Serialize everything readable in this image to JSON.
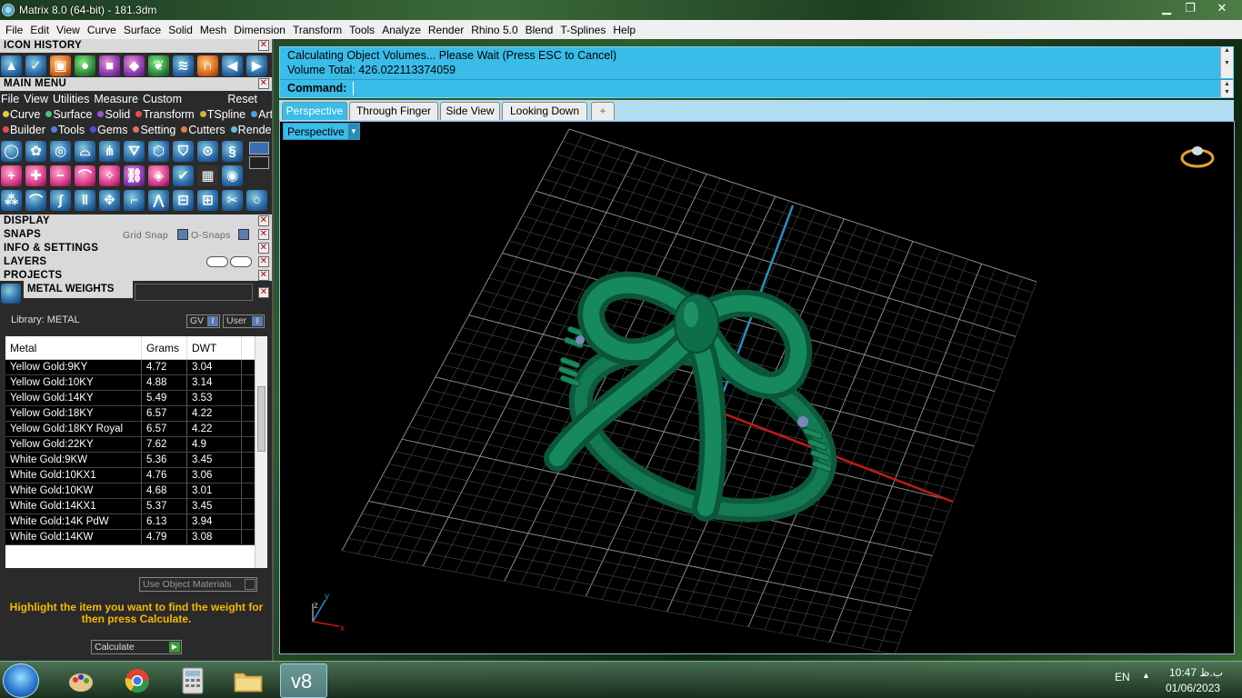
{
  "window": {
    "title": "Matrix 8.0 (64-bit) - 181.3dm",
    "min_label": "▁",
    "max_label": "❐",
    "close_label": "✕"
  },
  "menubar": [
    "File",
    "Edit",
    "View",
    "Curve",
    "Surface",
    "Solid",
    "Mesh",
    "Dimension",
    "Transform",
    "Tools",
    "Analyze",
    "Render",
    "Rhino 5.0",
    "Blend",
    "T-Splines",
    "Help"
  ],
  "left": {
    "icon_history": "ICON HISTORY",
    "main_menu": "MAIN MENU",
    "mm_items": [
      "File",
      "View",
      "Utilities",
      "Measure",
      "Custom"
    ],
    "reset": "Reset",
    "cat_row1": [
      {
        "label": "Curve",
        "color": "#e8c840"
      },
      {
        "label": "Surface",
        "color": "#40c878"
      },
      {
        "label": "Solid",
        "color": "#a050d0"
      },
      {
        "label": "Transform",
        "color": "#e05050"
      },
      {
        "label": "TSpline",
        "color": "#d0b040"
      },
      {
        "label": "Art",
        "color": "#50a0e0"
      }
    ],
    "cat_row2": [
      {
        "label": "Builder",
        "color": "#e05050"
      },
      {
        "label": "Tools",
        "color": "#5080e0"
      },
      {
        "label": "Gems",
        "color": "#5050d0"
      },
      {
        "label": "Setting",
        "color": "#e07070"
      },
      {
        "label": "Cutters",
        "color": "#e08040"
      },
      {
        "label": "Render",
        "color": "#60c0e0"
      }
    ],
    "display": "DISPLAY",
    "snaps": "SNAPS",
    "grid_snap": "Grid Snap",
    "o_snaps": "O-Snaps",
    "info_settings": "INFO & SETTINGS",
    "layers": "LAYERS",
    "projects": "PROJECTS",
    "metal_weights": "METAL WEIGHTS",
    "library": "Library: METAL",
    "gv": "GV",
    "user": "User",
    "table": {
      "headers": [
        "Metal",
        "Grams",
        "DWT"
      ],
      "rows": [
        [
          "Yellow Gold:9KY",
          "4.72",
          "3.04"
        ],
        [
          "Yellow Gold:10KY",
          "4.88",
          "3.14"
        ],
        [
          "Yellow Gold:14KY",
          "5.49",
          "3.53"
        ],
        [
          "Yellow Gold:18KY",
          "6.57",
          "4.22"
        ],
        [
          "Yellow Gold:18KY Royal",
          "6.57",
          "4.22"
        ],
        [
          "Yellow Gold:22KY",
          "7.62",
          "4.9"
        ],
        [
          "White Gold:9KW",
          "5.36",
          "3.45"
        ],
        [
          "White Gold:10KX1",
          "4.76",
          "3.06"
        ],
        [
          "White Gold:10KW",
          "4.68",
          "3.01"
        ],
        [
          "White Gold:14KX1",
          "5.37",
          "3.45"
        ],
        [
          "White Gold:14K PdW",
          "6.13",
          "3.94"
        ],
        [
          "White Gold:14KW",
          "4.79",
          "3.08"
        ]
      ]
    },
    "use_object_materials": "Use Object Materials",
    "hint": "Highlight the item you want to find the weight for then press Calculate.",
    "calculate": "Calculate"
  },
  "command": {
    "line1": "Calculating Object Volumes... Please Wait (Press ESC to Cancel)",
    "line2": "Volume Total: 426.022113374059",
    "label": "Command:"
  },
  "tabs": [
    "Perspective",
    "Through Finger",
    "Side View",
    "Looking Down",
    "+"
  ],
  "viewport": {
    "mode": "Perspective",
    "axis_labels": {
      "x": "x",
      "y": "y",
      "z": "z"
    }
  },
  "taskbar": {
    "lang": "EN",
    "time": "10:47 ب.ظ",
    "date": "01/06/2023",
    "v8_label": "v8"
  },
  "colors": {
    "accent": "#39bce8",
    "ring_green": "#0f6e4a",
    "hint_yellow": "#f5b800"
  }
}
